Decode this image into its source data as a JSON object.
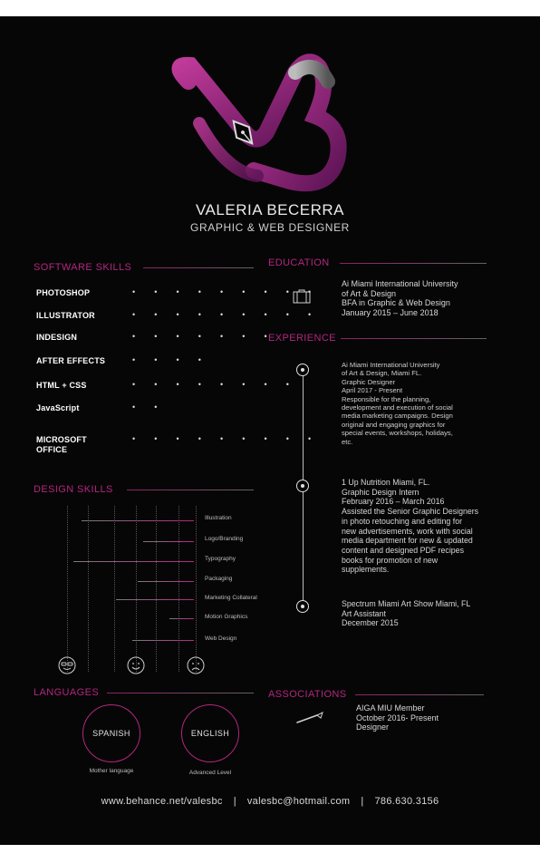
{
  "profile": {
    "name": "VALERIA BECERRA",
    "role": "GRAPHIC & WEB DESIGNER"
  },
  "sections": {
    "software": "SOFTWARE SKILLS",
    "design": "DESIGN SKILLS",
    "languages": "LANGUAGES",
    "education": "EDUCATION",
    "experience": "EXPERIENCE",
    "associations": "ASSOCIATIONS"
  },
  "software_skills": [
    {
      "label": "PHOTOSHOP",
      "dots": "• • • • • • • • •",
      "level": 9
    },
    {
      "label": "ILLUSTRATOR",
      "dots": "• • • • • • • • •",
      "level": 9
    },
    {
      "label": "INDESIGN",
      "dots": "• • • • • • •",
      "level": 7
    },
    {
      "label": "AFTER EFFECTS",
      "dots": "• • • •",
      "level": 4
    },
    {
      "label": "HTML + CSS",
      "dots": "• • • • • • • •",
      "level": 8
    },
    {
      "label": "JavaScript",
      "dots": "• •",
      "level": 2
    },
    {
      "label": "MICROSOFT\nOFFICE",
      "dots": "• • • • • • • • •",
      "level": 9
    }
  ],
  "design_skills": [
    {
      "label": "Illustration",
      "level": 0.16
    },
    {
      "label": "Logo/Branding",
      "level": 0.62
    },
    {
      "label": "Typography",
      "level": 0.1
    },
    {
      "label": "Packaging",
      "level": 0.58
    },
    {
      "label": "Marketing Collateral",
      "level": 0.42
    },
    {
      "label": "Motion Graphics",
      "level": 0.82
    },
    {
      "label": "Web Design",
      "level": 0.54
    }
  ],
  "languages": [
    {
      "name": "SPANISH",
      "level": "Mother language"
    },
    {
      "name": "ENGLISH",
      "level": "Advanced Level"
    }
  ],
  "education": {
    "icon": "briefcase-icon",
    "text": "Ai Miami International University\nof Art & Design\nBFA in Graphic & Web Design\nJanuary 2015 – June 2018"
  },
  "experience": [
    {
      "text": "Ai Miami International University\nof Art & Design, Miami FL.\nGraphic Designer\nApril 2017 - Present\nResponsible for the planning,\ndevelopment and execution of social\nmedia marketing campaigns. Design\noriginal and engaging graphics for\nspecial events, workshops, holidays,\netc."
    },
    {
      "text": "1 Up Nutrition Miami, FL.\nGraphic Design Intern\nFebruary 2016 – March 2016\nAssisted the Senior Graphic Designers\nin photo retouching and editing for\nnew advertisements, work with social\nmedia department for new & updated\ncontent and designed PDF recipes\nbooks for promotion of new\nsupplements."
    },
    {
      "text": "Spectrum Miami Art Show Miami, FL\nArt Assistant\nDecember 2015"
    }
  ],
  "associations": {
    "icon": "pen-brush-icon",
    "text": "AIGA MIU Member\nOctober 2016- Present\nDesigner"
  },
  "footer": {
    "website": "www.behance.net/valesbc",
    "email": "valesbc@hotmail.com",
    "phone": "786.630.3156",
    "separator": "|"
  },
  "colors": {
    "background": "#060606",
    "accent": "#b3267f",
    "text": "#ffffff"
  }
}
